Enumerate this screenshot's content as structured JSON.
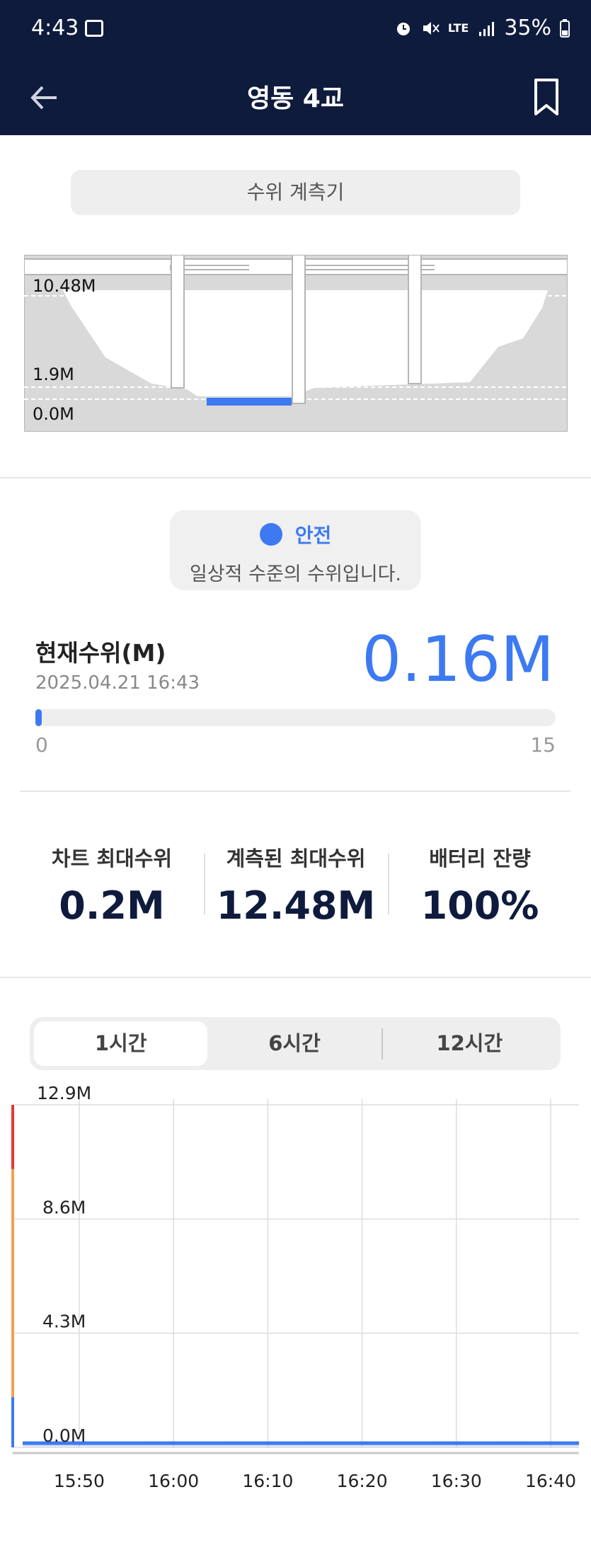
{
  "status_bar": {
    "time": "4:43",
    "network": "LTE",
    "battery": "35%"
  },
  "app_bar": {
    "title": "영동 4교"
  },
  "gauge": {
    "section_label": "수위 계측기",
    "levels": [
      {
        "label": "10.48M",
        "meters": 10.48
      },
      {
        "label": "1.9M",
        "meters": 1.9
      },
      {
        "label": "0.0M",
        "meters": 0.0
      }
    ]
  },
  "status": {
    "label": "안전",
    "description": "일상적 수준의 수위입니다.",
    "color": "#3d7af2"
  },
  "current": {
    "title": "현재수위(M)",
    "timestamp": "2025.04.21 16:43",
    "value": 0.16,
    "value_label": "0.16M",
    "min_label": "0",
    "max_label": "15",
    "max": 15
  },
  "stats": [
    {
      "label": "차트 최대수위",
      "value": "0.2M"
    },
    {
      "label": "계측된 최대수위",
      "value": "12.48M"
    },
    {
      "label": "배터리 잔량",
      "value": "100%"
    }
  ],
  "tabs": [
    {
      "label": "1시간",
      "active": true
    },
    {
      "label": "6시간",
      "active": false
    },
    {
      "label": "12시간",
      "active": false
    }
  ],
  "colors": {
    "navy": "#0f1b3d",
    "accent": "#3d7af2",
    "danger": "#e53935",
    "warning": "#f5a04a"
  },
  "chart_data": {
    "type": "area",
    "title": "",
    "xlabel": "",
    "ylabel": "",
    "y_tick_labels": [
      "12.9M",
      "8.6M",
      "4.3M",
      "0.0M"
    ],
    "y_ticks": [
      12.9,
      8.6,
      4.3,
      0.0
    ],
    "ylim": [
      0,
      12.9
    ],
    "x_tick_labels": [
      "15:50",
      "16:00",
      "16:10",
      "16:20",
      "16:30",
      "16:40"
    ],
    "series": [
      {
        "x": [
          "15:44",
          "15:50",
          "15:55",
          "16:00",
          "16:05",
          "16:10",
          "16:15",
          "16:20",
          "16:25",
          "16:30",
          "16:35",
          "16:40",
          "16:43"
        ],
        "values": [
          0.16,
          0.16,
          0.16,
          0.16,
          0.16,
          0.16,
          0.16,
          0.16,
          0.16,
          0.16,
          0.16,
          0.16,
          0.16
        ]
      }
    ],
    "threshold_bands": [
      {
        "from": 0.0,
        "to": 1.9,
        "color": "#3d7af2"
      },
      {
        "from": 1.9,
        "to": 10.48,
        "color": "#f5a04a"
      },
      {
        "from": 10.48,
        "to": 12.9,
        "color": "#e53935"
      }
    ],
    "grid": true
  }
}
